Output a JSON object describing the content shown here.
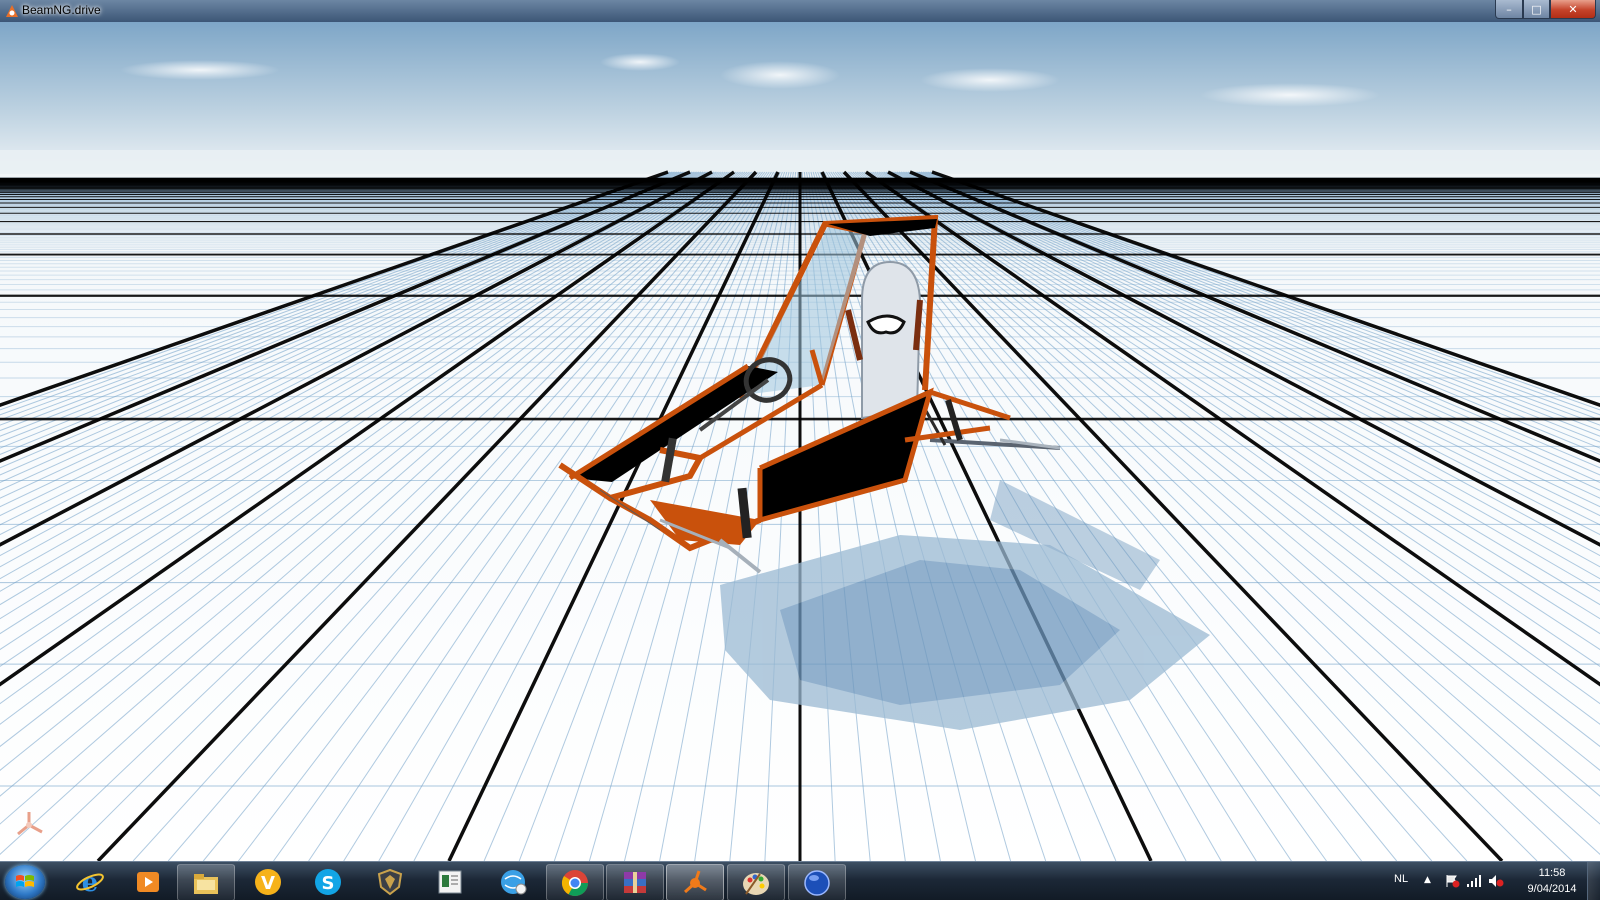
{
  "window": {
    "title": "BeamNG.drive",
    "controls": {
      "minimize": "–",
      "maximize": "□",
      "close": "✕"
    },
    "icon": "beamng-icon"
  },
  "scene": {
    "sky_color_top": "#7fa7c8",
    "horizon_color": "#eef3f6",
    "grid_major_color": "#000000",
    "grid_minor_color": "#6f9fc7",
    "vehicle_frame_color": "#c9510c",
    "vehicle_panel_color": "#000000",
    "seat_color": "#dfe4ea"
  },
  "taskbar": {
    "start": "start-button",
    "items": [
      {
        "name": "internet-explorer",
        "state": "pinned"
      },
      {
        "name": "media-player",
        "state": "pinned"
      },
      {
        "name": "file-explorer",
        "state": "open"
      },
      {
        "name": "vlc-v",
        "state": "pinned"
      },
      {
        "name": "skype",
        "state": "pinned"
      },
      {
        "name": "shield-app",
        "state": "pinned"
      },
      {
        "name": "document-app",
        "state": "pinned"
      },
      {
        "name": "network-globe",
        "state": "pinned"
      },
      {
        "name": "chrome",
        "state": "open"
      },
      {
        "name": "winrar",
        "state": "open"
      },
      {
        "name": "beamng",
        "state": "active"
      },
      {
        "name": "paint",
        "state": "open"
      },
      {
        "name": "blue-orb",
        "state": "open"
      }
    ],
    "tray": {
      "language": "NL",
      "time": "11:58",
      "date": "9/04/2014"
    }
  }
}
